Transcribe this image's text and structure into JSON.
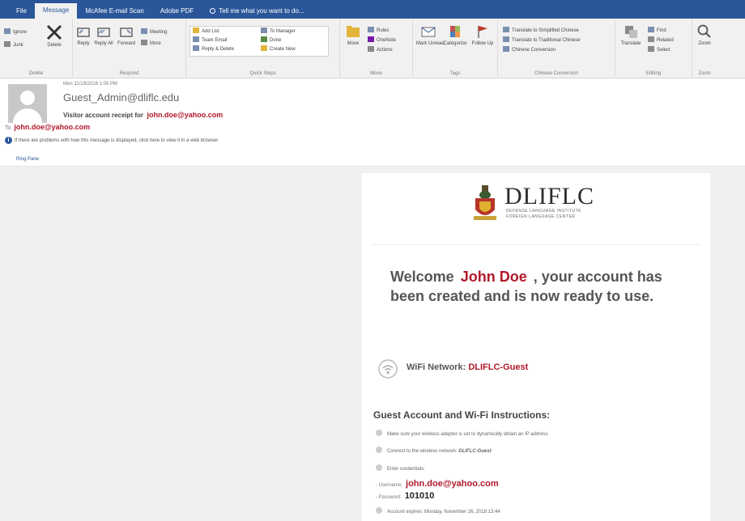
{
  "tabs": [
    {
      "label": "File",
      "active": false
    },
    {
      "label": "Message",
      "active": true
    },
    {
      "label": "McAfee E-mail Scan",
      "active": false
    },
    {
      "label": "Adobe PDF",
      "active": false
    }
  ],
  "tell_me": "Tell me what you want to do...",
  "ribbon": {
    "delete_group": {
      "ignore": "Ignore",
      "junk": "Junk",
      "delete": "Delete",
      "label": "Delete"
    },
    "respond_group": {
      "reply": "Reply",
      "reply_all": "Reply All",
      "forward": "Forward",
      "meeting": "Meeting",
      "more": "More",
      "label": "Respond"
    },
    "quick_steps": {
      "items": [
        "Add List",
        "Team Email",
        "Reply & Delete",
        "To Manager",
        "Done",
        "Create New"
      ],
      "label": "Quick Steps"
    },
    "move_group": {
      "move": "Move",
      "rules": "Rules",
      "onenote": "OneNote",
      "actions": "Actions",
      "label": "Move"
    },
    "tags_group": {
      "mark_unread": "Mark Unread",
      "categorize": "Categorize",
      "follow_up": "Follow Up",
      "label": "Tags"
    },
    "chinese_group": {
      "simplified": "Translate to Simplified Chinese",
      "traditional": "Translate to Traditional Chinese",
      "conversion": "Chinese Conversion",
      "label": "Chinese Conversion"
    },
    "editing_group": {
      "translate": "Translate",
      "find": "Find",
      "related": "Related",
      "select": "Select",
      "label": "Editing"
    },
    "zoom_group": {
      "zoom": "Zoom",
      "label": "Zoom"
    }
  },
  "header": {
    "date": "Mon 11/19/2018 1:05 PM",
    "from": "Guest_Admin@dliflc.edu",
    "subject_prefix": "Visitor account receipt for",
    "subject_email": "john.doe@yahoo.com",
    "to_label": "To",
    "to": "john.doe@yahoo.com",
    "info": "If there are problems with how this message is displayed, click here to view it in a web browser."
  },
  "action_bar": {
    "label": "Ring Pane"
  },
  "body": {
    "logo": {
      "name": "DLIFLC",
      "sub1": "DEFENSE LANGUAGE INSTITUTE",
      "sub2": "FOREIGN LANGUAGE CENTER"
    },
    "welcome_prefix": "Welcome",
    "welcome_name": "John Doe",
    "welcome_suffix": ", your account has been created and is now ready to use.",
    "wifi_label": "WiFi Network:",
    "wifi_network": "DLIFLC-Guest",
    "instructions_title": "Guest Account and Wi-Fi Instructions:",
    "step1": "Make sure your wireless adapter is set to dynamically obtain an IP address",
    "step2_prefix": "Connect to the wireless network:",
    "step2_network": "DLIFLC-Guest",
    "step3": "Enter credentials:",
    "username_label": "- Username:",
    "username": "john.doe@yahoo.com",
    "password_label": "- Password:",
    "password": "101010",
    "expires": "Account expires: Monday, November 26, 2018 13:44"
  },
  "colors": {
    "accent": "#2b579a",
    "highlight": "#b2182b"
  }
}
